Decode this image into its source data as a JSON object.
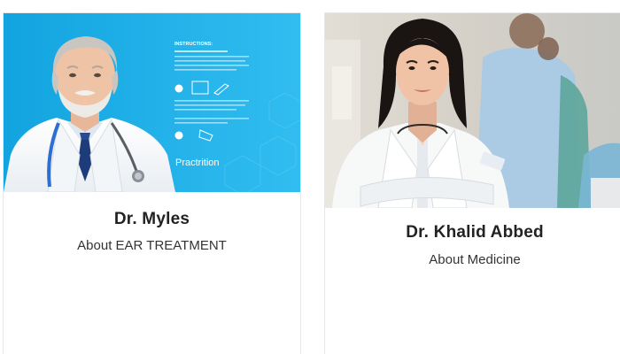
{
  "doctors": [
    {
      "name": "Dr. Myles",
      "about": "About EAR TREATMENT",
      "photo": {
        "poster_heading": "INSTRUCTIONS:",
        "poster_brand": "Practrition",
        "background_color": "#1fb1e6"
      }
    },
    {
      "name": "Dr. Khalid Abbed",
      "about": "About Medicine",
      "photo": {
        "background_color": "#d9d6d0"
      }
    }
  ],
  "colors": {
    "card_border": "#e7e7e7",
    "name_text": "#222222",
    "about_text": "#333333"
  }
}
